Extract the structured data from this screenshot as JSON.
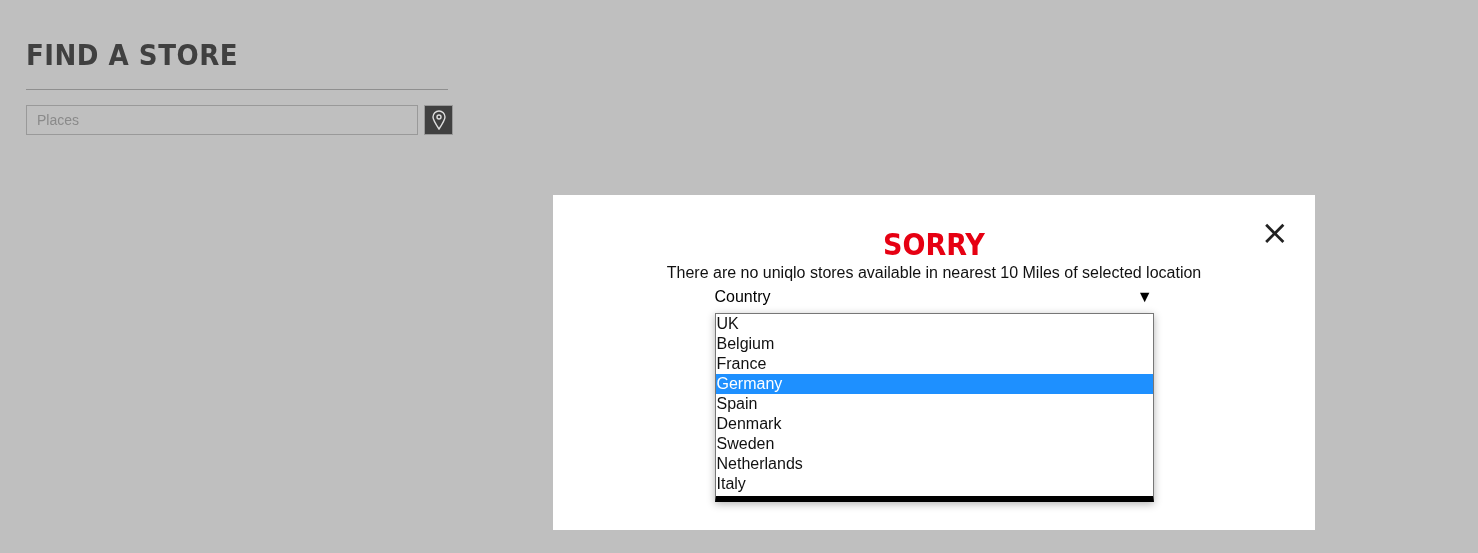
{
  "page": {
    "title": "FIND A STORE",
    "search": {
      "placeholder": "Places"
    }
  },
  "modal": {
    "title": "SORRY",
    "close": "×",
    "message": "There are no uniqlo stores available in nearest 10 Miles of selected location",
    "select": {
      "label": "Country",
      "arrow": "▼",
      "options": [
        {
          "label": "UK",
          "selected": false
        },
        {
          "label": "Belgium",
          "selected": false
        },
        {
          "label": "France",
          "selected": false
        },
        {
          "label": "Germany",
          "selected": true
        },
        {
          "label": "Spain",
          "selected": false
        },
        {
          "label": "Denmark",
          "selected": false
        },
        {
          "label": "Sweden",
          "selected": false
        },
        {
          "label": "Netherlands",
          "selected": false
        },
        {
          "label": "Italy",
          "selected": false
        }
      ]
    }
  }
}
